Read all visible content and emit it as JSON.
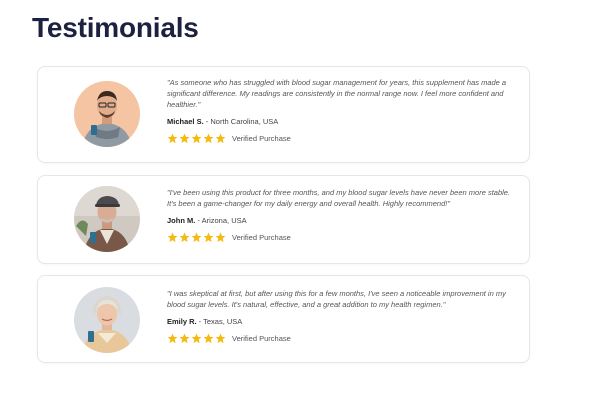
{
  "heading": "Testimonials",
  "colors": {
    "heading": "#1d2140",
    "star": "#f5b90f",
    "card_border": "#e6e6e6"
  },
  "testimonials": [
    {
      "quote": "\"As someone who has struggled with blood sugar management for years, this supplement has made a significant difference. My readings are consistently in the normal range now. I feel more confident and healthier.\"",
      "name": "Michael S.",
      "location": " - North Carolina, USA",
      "rating": 5,
      "verified": "Verified Purchase",
      "avatar_icon": "man-with-scarf-avatar"
    },
    {
      "quote": "\"I've been using this product for three months, and my blood sugar levels have never been more stable. It's been a game-changer for my daily energy and overall health. Highly recommend!\"",
      "name": "John M.",
      "location": " - Arizona, USA",
      "rating": 5,
      "verified": "Verified Purchase",
      "avatar_icon": "older-man-with-cap-avatar"
    },
    {
      "quote": "\"I was skeptical at first, but after using this for a few months, I've seen a noticeable improvement in my blood sugar levels. It's natural, effective, and a great addition to my health regimen.\"",
      "name": "Emily R.",
      "location": " - Texas, USA",
      "rating": 5,
      "verified": "Verified Purchase",
      "avatar_icon": "older-woman-avatar"
    }
  ]
}
